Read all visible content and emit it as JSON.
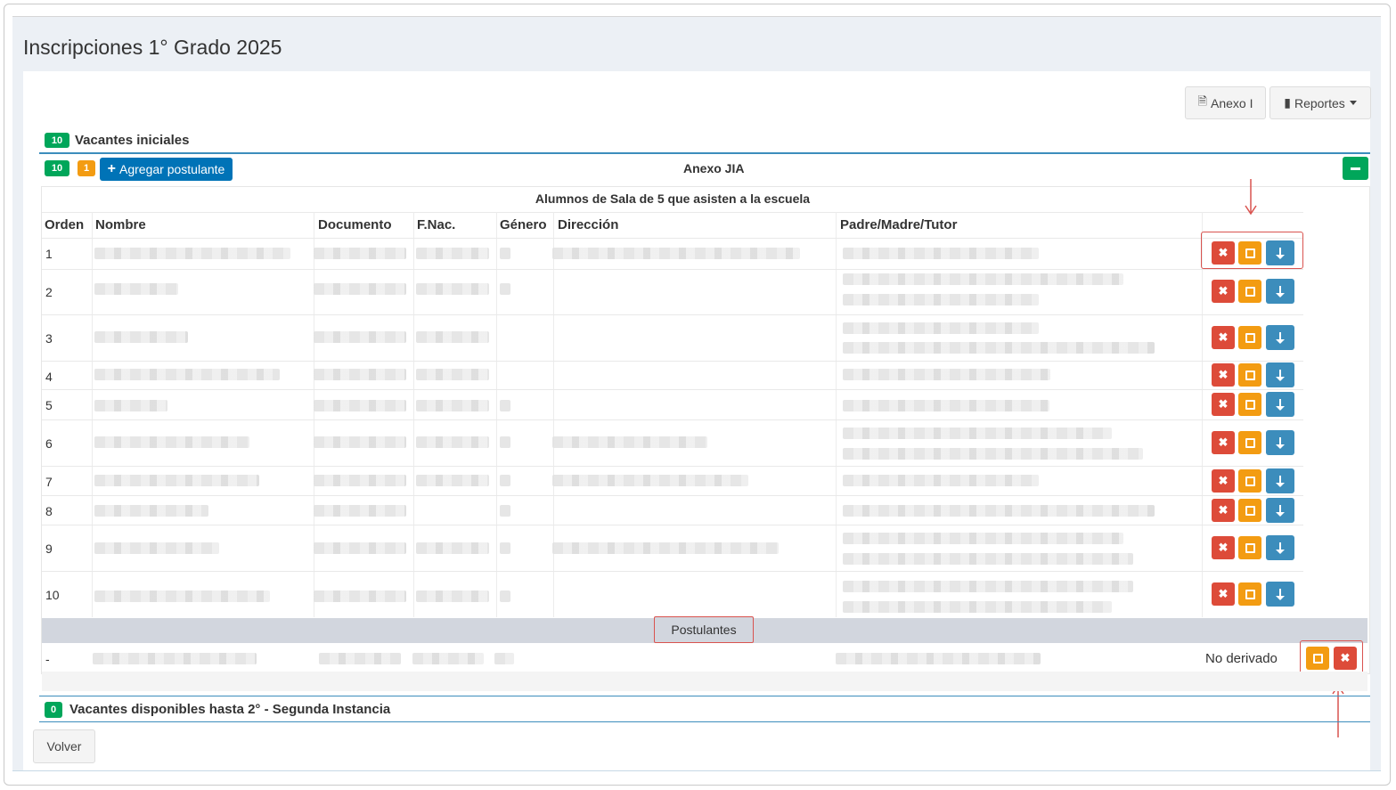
{
  "page": {
    "title": "Inscripciones 1° Grado 2025"
  },
  "toolbar": {
    "anexo_label": "Anexo I",
    "reportes_label": "Reportes"
  },
  "vacantes_iniciales": {
    "badge": "10",
    "label": "Vacantes iniciales"
  },
  "anexo_section": {
    "badge_green": "10",
    "badge_orange": "1",
    "add_label": "Agregar postulante",
    "title": "Anexo JIA"
  },
  "table": {
    "subheading": "Alumnos de Sala de 5 que asisten a la escuela",
    "headers": {
      "orden": "Orden",
      "nombre": "Nombre",
      "documento": "Documento",
      "fnac": "F.Nac.",
      "genero": "Género",
      "direccion": "Dirección",
      "tutor": "Padre/Madre/Tutor"
    },
    "row_numbers": [
      "1",
      "2",
      "3",
      "4",
      "5",
      "6",
      "7",
      "8",
      "9",
      "10"
    ]
  },
  "postulantes": {
    "label": "Postulantes",
    "row": {
      "orden": "-",
      "status": "No derivado"
    }
  },
  "vacantes_segunda": {
    "badge": "0",
    "label": "Vacantes disponibles hasta 2° - Segunda Instancia"
  },
  "footer": {
    "volver_label": "Volver"
  },
  "colors": {
    "danger": "#dd4b39",
    "warning": "#f39c12",
    "primary": "#3c8dbc",
    "success": "#00a65a",
    "annotation": "#d9534f"
  },
  "icons": {
    "anexo": "pdf-file-icon",
    "reportes": "file-icon",
    "add": "plus-icon",
    "collapse": "minus-icon",
    "delete": "times-icon",
    "edit": "edit-icon",
    "move_down": "arrow-down-icon"
  }
}
